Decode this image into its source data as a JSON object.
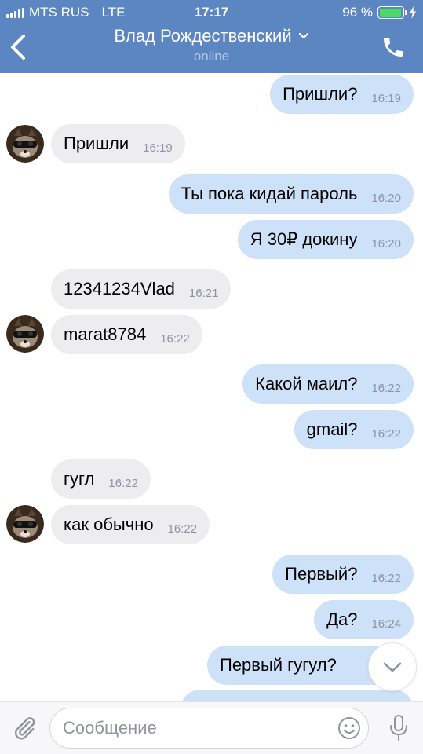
{
  "status_bar": {
    "carrier": "MTS RUS",
    "network": "LTE",
    "time": "17:17",
    "battery": "96 %",
    "battery_level": 0.96
  },
  "header": {
    "title": "Влад Рождественский",
    "subtitle": "online",
    "colors": {
      "background": "#5b86c1",
      "subtitle": "#a9c0df"
    }
  },
  "messages": [
    {
      "dir": "out",
      "text": "Пришли?",
      "time": "16:19",
      "avatar": false
    },
    {
      "dir": "in",
      "text": "Пришли",
      "time": "16:19",
      "avatar": true
    },
    {
      "dir": "out",
      "text": "Ты пока кидай пароль",
      "time": "16:20",
      "avatar": false
    },
    {
      "dir": "out",
      "text": "Я 30₽ докину",
      "time": "16:20",
      "avatar": false
    },
    {
      "dir": "in",
      "text": "12341234Vlad",
      "time": "16:21",
      "avatar": false
    },
    {
      "dir": "in",
      "text": "marat8784",
      "time": "16:22",
      "avatar": true
    },
    {
      "dir": "out",
      "text": "Какой маил?",
      "time": "16:22",
      "avatar": false
    },
    {
      "dir": "out",
      "text": "gmail?",
      "time": "16:22",
      "avatar": false
    },
    {
      "dir": "in",
      "text": "гугл",
      "time": "16:22",
      "avatar": false
    },
    {
      "dir": "in",
      "text": "как обычно",
      "time": "16:22",
      "avatar": true
    },
    {
      "dir": "out",
      "text": "Первый?",
      "time": "16:22",
      "avatar": false
    },
    {
      "dir": "out",
      "text": "Да?",
      "time": "16:24",
      "avatar": false
    },
    {
      "dir": "out",
      "text": "Первый гугул?",
      "time": "",
      "avatar": false
    }
  ],
  "composer": {
    "placeholder": "Сообщение",
    "value": ""
  },
  "icons": {
    "back": "chevron-left-icon",
    "title_dropdown": "chevron-down-icon",
    "call": "phone-icon",
    "attach": "paperclip-icon",
    "emoji": "smile-icon",
    "mic": "microphone-icon",
    "scroll_down": "chevron-down-icon"
  },
  "colors": {
    "bubble_out": "#cde1f8",
    "bubble_in": "#ededf0",
    "time_text": "#8a94a4",
    "battery_fill": "#4cd964"
  }
}
